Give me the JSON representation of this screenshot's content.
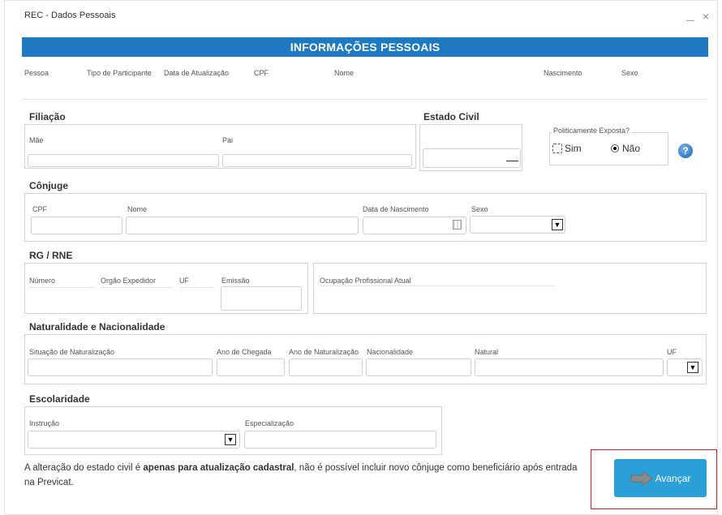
{
  "window": {
    "title": "REC - Dados Pessoais",
    "minimize_glyph": "—",
    "close_glyph": "×"
  },
  "header": {
    "title": "INFORMAÇÕES PESSOAIS",
    "bg_color": "#1f79c0",
    "columns": [
      "Pessoa",
      "Tipo de Participante",
      "Data de Atualização",
      "CPF",
      "Nome",
      "Nascimento",
      "Sexo"
    ]
  },
  "filiacao": {
    "title": "Filiação",
    "mae_label": "Mãe",
    "pai_label": "Pai"
  },
  "estado_civil": {
    "title": "Estado Civil"
  },
  "pep": {
    "legend": "Politicamente Exposta?",
    "options": [
      "Sim",
      "Não"
    ],
    "selected": "Não",
    "help_icon": "question-circle-icon"
  },
  "conjuge": {
    "title": "Cônjuge",
    "labels": [
      "CPF",
      "Nome",
      "Data de Nascimento",
      "Sexo"
    ]
  },
  "rg": {
    "title": "RG / RNE",
    "labels": [
      "Número",
      "Orgão Expedidor",
      "UF",
      "Emissão"
    ],
    "ocupacao_label": "Ocupação Profissional Atual"
  },
  "naturalidade": {
    "title": "Naturalidade e Nacionalidade",
    "labels": [
      "Situação de Naturalização",
      "Ano de Chegada",
      "Ano de Naturalização",
      "Nacionalidade",
      "Natural",
      "UF"
    ]
  },
  "escolaridade": {
    "title": "Escolaridade",
    "labels": [
      "Instrução",
      "Especialização"
    ]
  },
  "footer": {
    "notice_part1": "A alteração do estado civil é ",
    "notice_bold": "apenas para atualização cadastral",
    "notice_part2": ", não é possível incluir novo cônjuge como beneficiário após entrada na Previcat.",
    "advance_label": "Avançar",
    "advance_color": "#2a9fd8",
    "highlight_color": "#e02020"
  }
}
